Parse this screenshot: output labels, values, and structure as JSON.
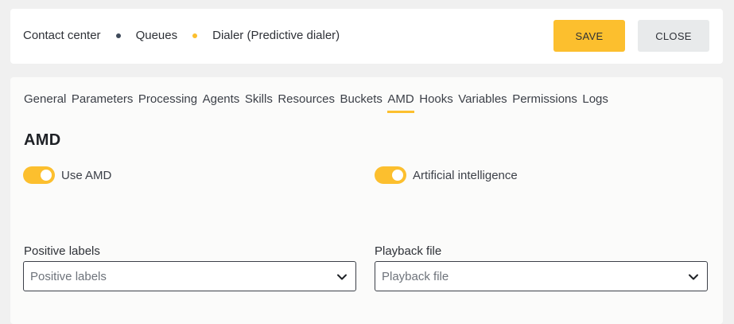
{
  "colors": {
    "accent": "#fcbf2e",
    "dot_dark": "#3f4a5a",
    "close_bg": "#e8eaeb"
  },
  "header": {
    "breadcrumb": [
      "Contact center",
      "Queues",
      "Dialer (Predictive dialer)"
    ],
    "save_label": "SAVE",
    "close_label": "CLOSE"
  },
  "tabs": [
    {
      "label": "General",
      "active": false
    },
    {
      "label": "Parameters",
      "active": false
    },
    {
      "label": "Processing",
      "active": false
    },
    {
      "label": "Agents",
      "active": false
    },
    {
      "label": "Skills",
      "active": false
    },
    {
      "label": "Resources",
      "active": false
    },
    {
      "label": "Buckets",
      "active": false
    },
    {
      "label": "AMD",
      "active": true
    },
    {
      "label": "Hooks",
      "active": false
    },
    {
      "label": "Variables",
      "active": false
    },
    {
      "label": "Permissions",
      "active": false
    },
    {
      "label": "Logs",
      "active": false
    }
  ],
  "section": {
    "title": "AMD",
    "toggles": [
      {
        "label": "Use AMD",
        "on": true
      },
      {
        "label": "Artificial intelligence",
        "on": true
      }
    ],
    "fields": [
      {
        "label": "Positive labels",
        "placeholder": "Positive labels",
        "icon": "chevron-down-icon"
      },
      {
        "label": "Playback file",
        "placeholder": "Playback file",
        "icon": "chevron-down-icon"
      }
    ]
  }
}
